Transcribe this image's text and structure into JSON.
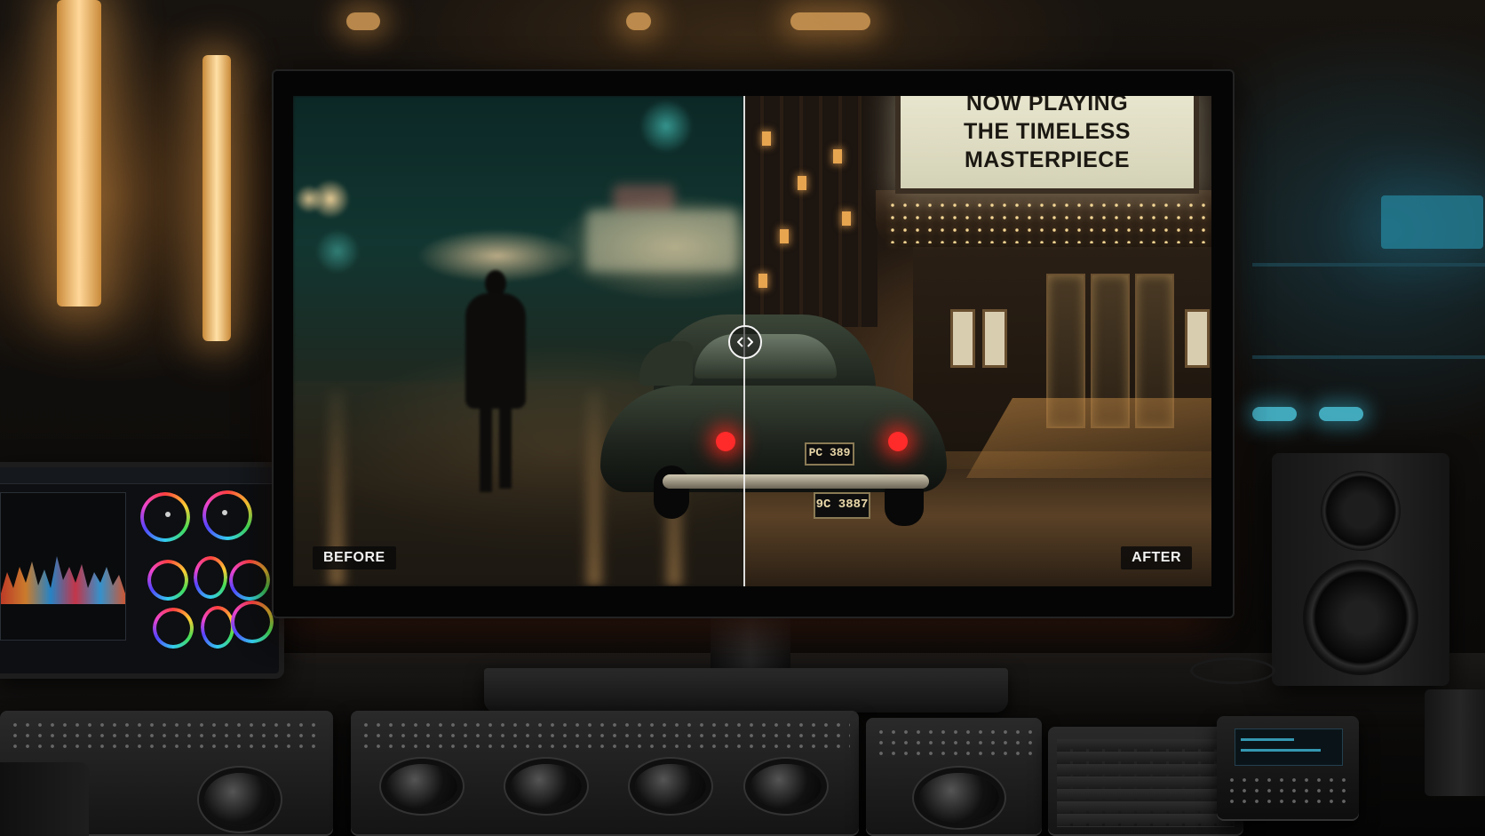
{
  "scene": {
    "description_tag": "color-grading-suite",
    "accent_colors": {
      "warm_light": "#e0a55a",
      "teal_light": "#2aa8c8",
      "tail_light": "#ff2a2a",
      "marquee": "#e9e6cf"
    }
  },
  "comparison": {
    "before_label": "BEFORE",
    "after_label": "AFTER",
    "split_position_fraction": 0.49,
    "handle_icon": "split-arrows-icon"
  },
  "marquee": {
    "lines": [
      "NOW PLAYING",
      "THE TIMELESS",
      "MASTERPIECE"
    ]
  },
  "car": {
    "plate_upper": "PC 389",
    "plate_lower": "9C 3887"
  }
}
